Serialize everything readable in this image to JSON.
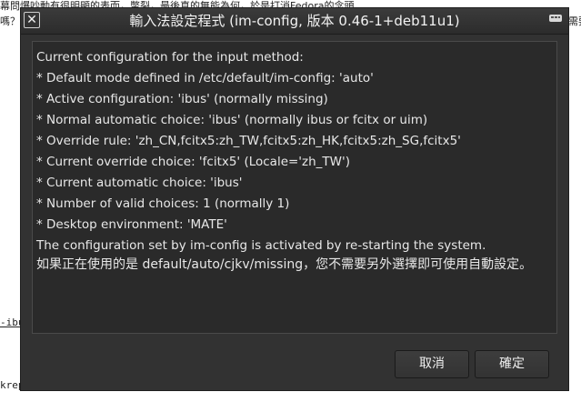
{
  "background": {
    "line1": "幕問爆吵動有很明顯的表而，幣裂，最後真的無能為何，於是打消Fedora的念頭",
    "line2": "嗎？",
    "line2b": "需要",
    "line3": "-ibu",
    "line4": "krep"
  },
  "dialog": {
    "title": "輸入法設定程式 (im-config, 版本 0.46-1+deb11u1)",
    "close_label": "✕",
    "lines": [
      "Current configuration for the input method:",
      " * Default mode defined in /etc/default/im-config: 'auto'",
      " * Active configuration: 'ibus' (normally missing)",
      " * Normal automatic choice: 'ibus' (normally ibus or fcitx or uim)",
      " * Override rule: 'zh_CN,fcitx5:zh_TW,fcitx5:zh_HK,fcitx5:zh_SG,fcitx5'",
      " * Current override choice: 'fcitx5' (Locale='zh_TW')",
      " * Current automatic choice: 'ibus'",
      " * Number of valid choices: 1 (normally 1)",
      " * Desktop environment: 'MATE'",
      "The configuration set by im-config is activated by re-starting the system.",
      "如果正在使用的是 default/auto/cjkv/missing，您不需要另外選擇即可使用自動設定。"
    ],
    "cancel_label": "取消",
    "ok_label": "確定"
  },
  "colors": {
    "dialog_bg": "#323232",
    "content_bg": "#2a2a2a",
    "text": "#e8e8e8"
  },
  "icons": {
    "close": "close-icon",
    "window": "keyboard-icon"
  }
}
